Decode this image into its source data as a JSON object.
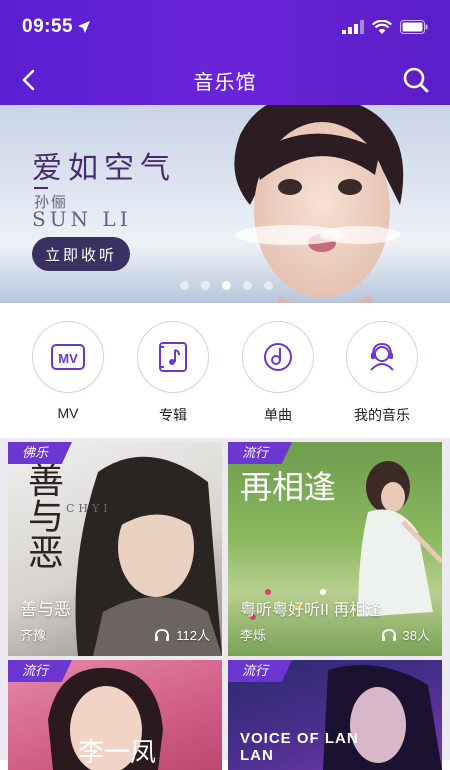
{
  "status": {
    "time": "09:55"
  },
  "nav": {
    "title": "音乐馆"
  },
  "banner": {
    "headline": "爱如空气",
    "artist_cn": "孙俪",
    "artist_en": "SUN LI",
    "button": "立即收听",
    "dots": 5,
    "active_dot": 3
  },
  "quick": [
    {
      "label": "MV",
      "icon": "mv-icon"
    },
    {
      "label": "专辑",
      "icon": "album-icon"
    },
    {
      "label": "单曲",
      "icon": "single-icon"
    },
    {
      "label": "我的音乐",
      "icon": "my-music-icon"
    }
  ],
  "cards": [
    {
      "tag": "佛乐",
      "title": "善与恶",
      "artist": "齐豫",
      "listeners": "112人",
      "art_text": "善与恶",
      "art_sub": "CHYI"
    },
    {
      "tag": "流行",
      "title": "粤听粤好听II 再相逢",
      "artist": "李烁",
      "listeners": "38人",
      "art_text": "再相逢",
      "art_sub": "粤听粤好听"
    },
    {
      "tag": "流行",
      "art_text": "李一凤"
    },
    {
      "tag": "流行",
      "art_text": "VOICE OF LAN LAN"
    }
  ],
  "colors": {
    "accent": "#6a24d8",
    "tag": "#6c37d1"
  }
}
